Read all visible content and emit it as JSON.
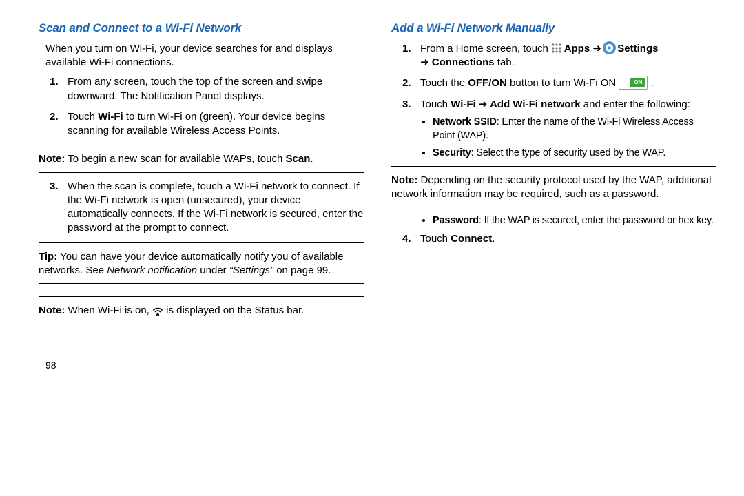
{
  "left": {
    "heading": "Scan and Connect to a Wi-Fi Network",
    "intro": "When you turn on Wi-Fi, your device searches for and displays available Wi-Fi connections.",
    "step1": "From any screen, touch the top of the screen and swipe downward. The Notification Panel displays.",
    "step2_pre": "Touch ",
    "step2_wifi": "Wi-Fi",
    "step2_post": " to turn Wi-Fi on (green). Your device begins scanning for available Wireless Access Points.",
    "note1_label": "Note:",
    "note1_body": " To begin a new scan for available WAPs, touch ",
    "note1_scan": "Scan",
    "note1_end": ".",
    "step3": "When the scan is complete, touch a Wi-Fi network to connect. If the Wi-Fi network is open (unsecured), your device automatically connects. If the Wi-Fi network is secured, enter the password at the prompt to connect.",
    "tip_label": "Tip:",
    "tip_body1": " You can have your device automatically notify you of available networks. See ",
    "tip_netnotif": "Network notification",
    "tip_body2": " under ",
    "tip_settings": "“Settings”",
    "tip_body3": " on page 99.",
    "note2_label": "Note:",
    "note2_pre": " When Wi-Fi is on, ",
    "note2_post": " is displayed on the Status bar."
  },
  "right": {
    "heading": "Add a Wi-Fi Network Manually",
    "s1_pre": "From a Home screen, touch ",
    "s1_apps": " Apps ",
    "s1_settings": " Settings ",
    "s1_conn": " Connections",
    "s1_tab": " tab.",
    "s2_pre": "Touch the ",
    "s2_offon": "OFF/ON",
    "s2_mid": " button to turn Wi-Fi ON  ",
    "s2_end": " .",
    "s3_pre": "Touch ",
    "s3_wifi": "Wi-Fi ",
    "s3_add": " Add Wi-Fi network",
    "s3_post": " and enter the following:",
    "b1_label": "Network SSID",
    "b1_body": ": Enter the name of the Wi-Fi Wireless Access Point (WAP).",
    "b2_label": "Security",
    "b2_body": ": Select the type of security used by the WAP.",
    "note_label": "Note:",
    "note_body": " Depending on the security protocol used by the WAP, additional network information may be required, such as a password.",
    "b3_label": "Password",
    "b3_body": ": If the WAP is secured, enter the password or hex key.",
    "s4_pre": "Touch ",
    "s4_connect": "Connect",
    "s4_end": "."
  },
  "arrow": "➜",
  "page": "98"
}
